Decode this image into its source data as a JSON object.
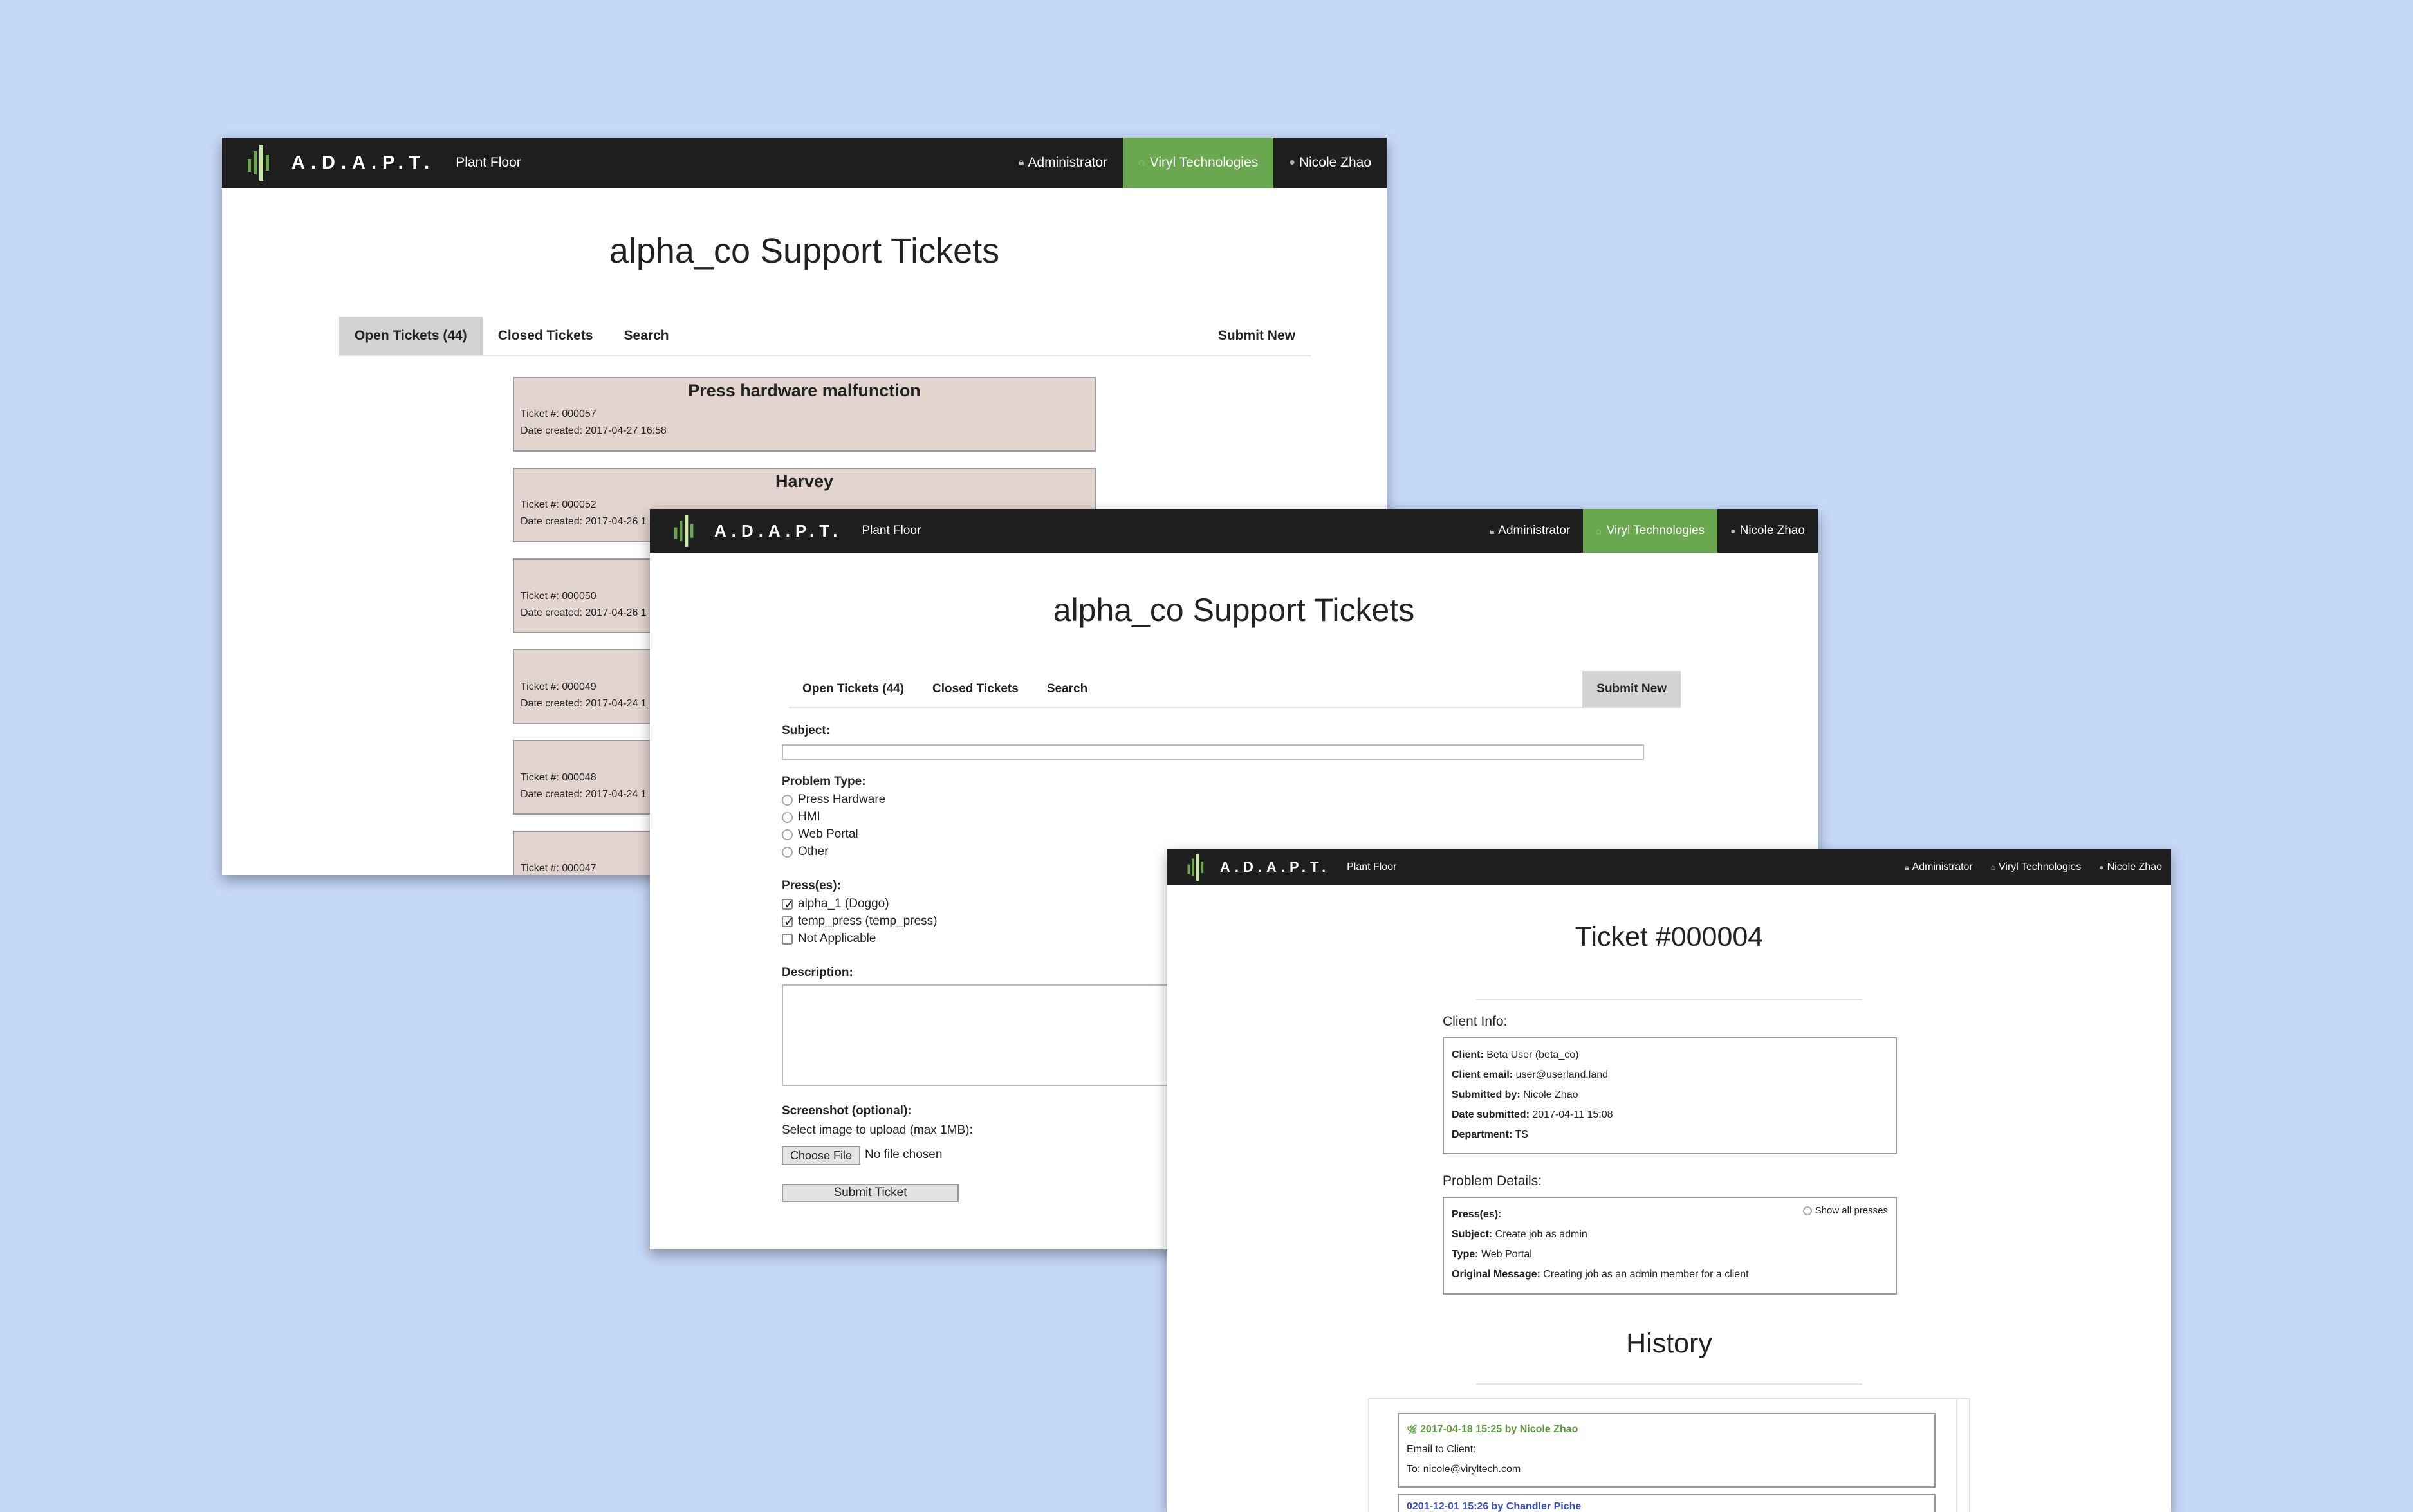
{
  "nav": {
    "brand": "A.D.A.P.T.",
    "section": "Plant Floor",
    "role": "Administrator",
    "company": "Viryl Technologies",
    "user": "Nicole Zhao",
    "accent_color": "#6aa84f",
    "bar_color": "#1e1e1e"
  },
  "list_view": {
    "title": "alpha_co Support Tickets",
    "tabs": {
      "open": "Open Tickets (44)",
      "closed": "Closed Tickets",
      "search": "Search",
      "submit": "Submit New"
    },
    "tickets": [
      {
        "title": "Press hardware malfunction",
        "number": "Ticket #: 000057",
        "date": "Date created: 2017-04-27 16:58"
      },
      {
        "title": "Harvey",
        "number": "Ticket #: 000052",
        "date": "Date created: 2017-04-26 1"
      },
      {
        "title": "",
        "number": "Ticket #: 000050",
        "date": "Date created: 2017-04-26 1"
      },
      {
        "title": "",
        "number": "Ticket #: 000049",
        "date": "Date created: 2017-04-24 1"
      },
      {
        "title": "",
        "number": "Ticket #: 000048",
        "date": "Date created: 2017-04-24 1"
      },
      {
        "title": "",
        "number": "Ticket #: 000047",
        "date": ""
      }
    ]
  },
  "form_view": {
    "title": "alpha_co Support Tickets",
    "tabs": {
      "open": "Open Tickets (44)",
      "closed": "Closed Tickets",
      "search": "Search",
      "submit": "Submit New"
    },
    "subject_label": "Subject:",
    "subject_value": "",
    "problem_type_label": "Problem Type:",
    "problem_types": [
      {
        "label": "Press Hardware",
        "selected": false
      },
      {
        "label": "HMI",
        "selected": false
      },
      {
        "label": "Web Portal",
        "selected": false
      },
      {
        "label": "Other",
        "selected": false
      }
    ],
    "presses_label": "Press(es):",
    "presses": [
      {
        "label": "alpha_1 (Doggo)",
        "checked": true
      },
      {
        "label": "temp_press (temp_press)",
        "checked": true
      },
      {
        "label": "Not Applicable",
        "checked": false
      }
    ],
    "description_label": "Description:",
    "description_value": "",
    "screenshot_label": "Screenshot (optional):",
    "upload_hint": "Select image to upload (max 1MB):",
    "choose_file": "Choose File",
    "no_file": "No file chosen",
    "submit": "Submit Ticket"
  },
  "detail_view": {
    "title": "Ticket #000004",
    "client_info_label": "Client Info:",
    "client_info": [
      {
        "key": "Client:",
        "value": "Beta User (beta_co)"
      },
      {
        "key": "Client email:",
        "value": "user@userland.land"
      },
      {
        "key": "Submitted by:",
        "value": "Nicole Zhao"
      },
      {
        "key": "Date submitted:",
        "value": "2017-04-11 15:08"
      },
      {
        "key": "Department:",
        "value": "TS"
      }
    ],
    "problem_details_label": "Problem Details:",
    "show_all": "Show all presses",
    "problem_details": [
      {
        "key": "Press(es):",
        "value": ""
      },
      {
        "key": "Subject:",
        "value": "Create job as admin"
      },
      {
        "key": "Type:",
        "value": "Web Portal"
      },
      {
        "key": "Original Message:",
        "value": "Creating job as an admin member for a client"
      }
    ],
    "history_title": "History",
    "history": [
      {
        "header": "2017-04-18 15:25 by Nicole Zhao",
        "link": "Email to Client:",
        "to": "To: nicole@viryltech.com",
        "color": "#5a9a3a"
      },
      {
        "header": "0201-12-01 15:26 by Chandler Piche",
        "link": "",
        "to": "",
        "color": "#3a4fc8"
      }
    ]
  }
}
